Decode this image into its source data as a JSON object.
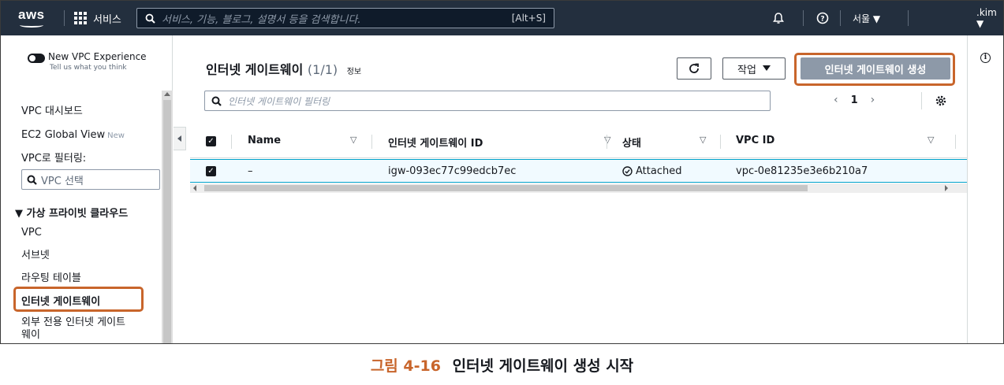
{
  "topnav": {
    "logo": "aws",
    "services_label": "서비스",
    "search_placeholder": "서비스, 기능, 블로그, 설명서 등을 검색합니다.",
    "search_shortcut": "[Alt+S]",
    "region": "서울 ▼",
    "user": ".kim ▼"
  },
  "sidebar": {
    "toggle_title": "New VPC Experience",
    "toggle_sub": "Tell us what you think",
    "items": {
      "dashboard": "VPC 대시보드",
      "ec2_global": "EC2 Global View",
      "ec2_global_badge": "New",
      "filter_label": "VPC로 필터링:",
      "vpc_select": "VPC 선택",
      "section": "▼ 가상 프라이빗 클라우드",
      "vpc": "VPC",
      "subnet": "서브넷",
      "route_table": "라우팅 테이블",
      "igw": "인터넷 게이트웨이",
      "egress_igw": "외부 전용 인터넷 게이트",
      "egress_igw_2": "웨이"
    }
  },
  "main": {
    "title": "인터넷 게이트웨이",
    "title_count": "(1/1)",
    "title_info": "정보",
    "action_label": "작업",
    "create_label": "인터넷 게이트웨이 생성",
    "filter_placeholder": "인터넷 게이트웨이 필터링",
    "page_number": "1",
    "columns": {
      "name": "Name",
      "igw_id": "인터넷 게이트웨이 ID",
      "state": "상태",
      "vpc_id": "VPC ID"
    },
    "row": {
      "name": "–",
      "igw_id": "igw-093ec77c99edcb7ec",
      "state": "Attached",
      "vpc_id": "vpc-0e81235e3e6b210a7"
    }
  },
  "caption": {
    "figure": "그림 4-16",
    "text": "인터넷 게이트웨이 생성 시작"
  },
  "colors": {
    "nav_bg": "#232f3e",
    "highlight": "#c8652b",
    "primary_disabled": "#8d99a8"
  }
}
